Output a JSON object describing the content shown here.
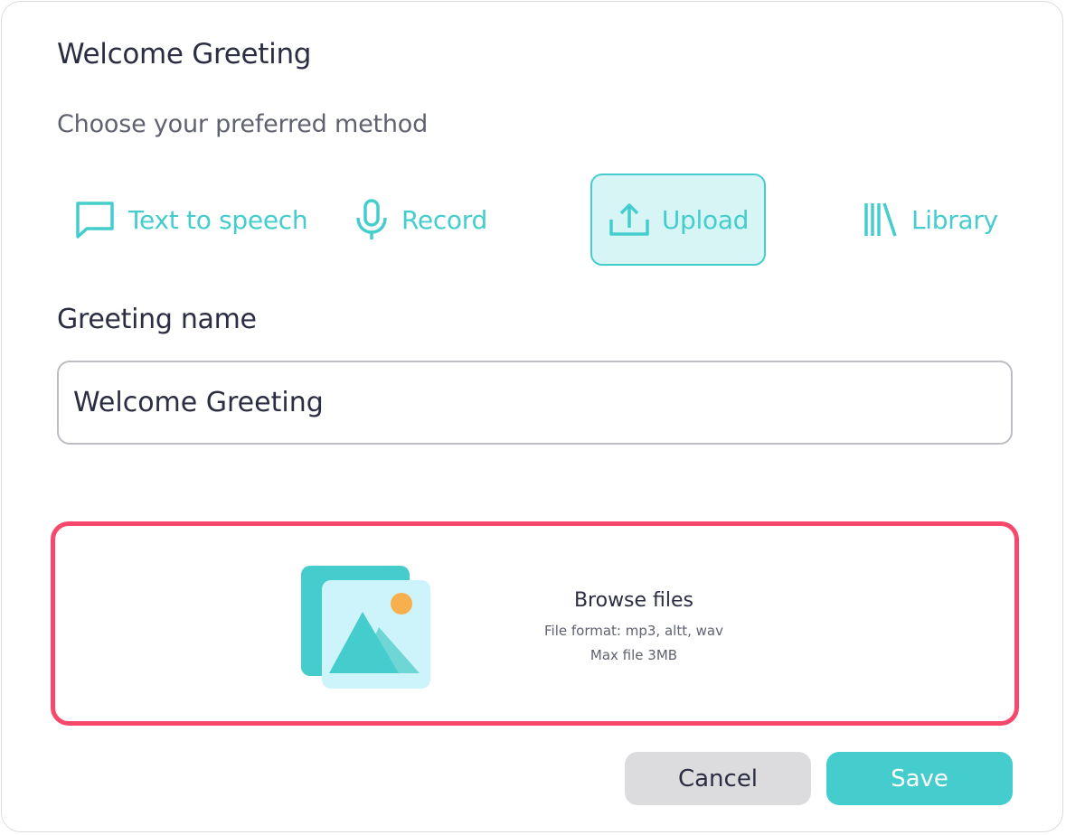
{
  "dialog": {
    "title": "Welcome Greeting",
    "subtitle": "Choose your preferred method"
  },
  "methods": [
    {
      "label": "Text to speech",
      "icon": "chat-bubble-icon",
      "selected": false
    },
    {
      "label": "Record",
      "icon": "microphone-icon",
      "selected": false
    },
    {
      "label": "Upload",
      "icon": "upload-icon",
      "selected": true
    },
    {
      "label": "Library",
      "icon": "library-icon",
      "selected": false
    }
  ],
  "greeting_name": {
    "label": "Greeting name",
    "value": "Welcome Greeting"
  },
  "upload_area": {
    "title": "Browse files",
    "format_text": "File format: mp3, altt, wav",
    "max_size_text": "Max file 3MB",
    "icon": "image-files-icon"
  },
  "actions": {
    "cancel_label": "Cancel",
    "save_label": "Save"
  },
  "colors": {
    "accent": "#45cdcd",
    "selected_bg": "#d7f5f5",
    "highlight_border": "#f7476b",
    "text_dark": "#2b2d42",
    "cancel_bg": "#dcdcdf"
  }
}
